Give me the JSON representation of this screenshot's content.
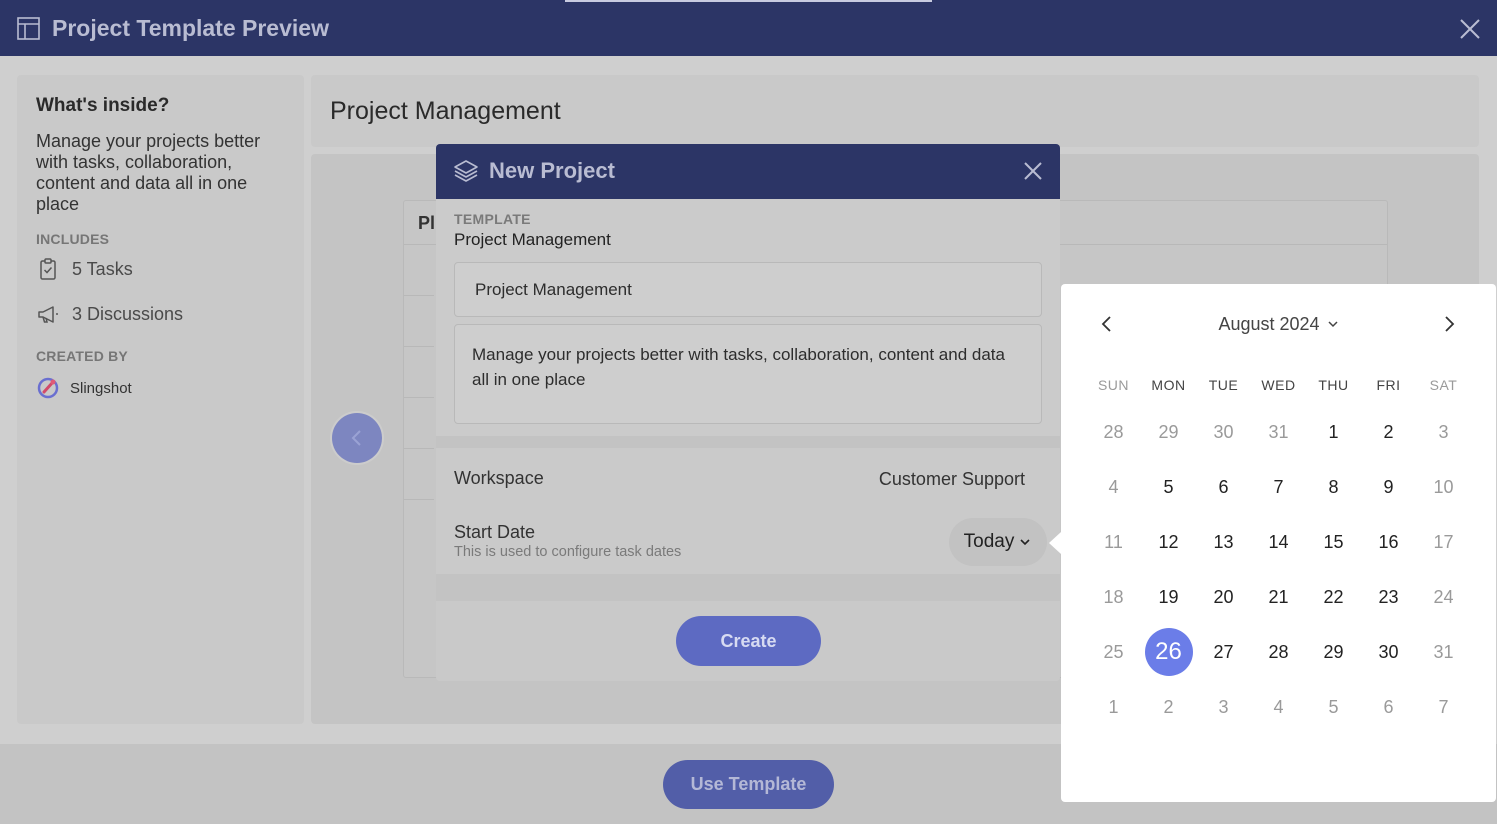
{
  "window": {
    "title": "Project Template Preview"
  },
  "left_panel": {
    "heading": "What's inside?",
    "description": "Manage your projects better with tasks, collaboration, content and data all in one place",
    "includes_label": "INCLUDES",
    "includes": [
      {
        "icon": "clipboard-check-icon",
        "label": "5 Tasks"
      },
      {
        "icon": "megaphone-icon",
        "label": "3 Discussions"
      }
    ],
    "created_by_label": "CREATED BY",
    "creator": "Slingshot"
  },
  "right_panel": {
    "title": "Project Management",
    "preview_header": "Pl"
  },
  "footer": {
    "use_template_label": "Use Template"
  },
  "modal": {
    "title": "New Project",
    "template_label": "TEMPLATE",
    "template_value": "Project Management",
    "name_value": "Project Management",
    "description_value": "Manage your projects better with tasks, collaboration, content and data all in one place",
    "workspace_label": "Workspace",
    "workspace_value": "Customer Support",
    "start_date_label": "Start Date",
    "start_date_hint": "This is used to configure task dates",
    "start_date_value": "Today",
    "create_label": "Create"
  },
  "calendar": {
    "month_label": "August 2024",
    "weekdays": [
      "SUN",
      "MON",
      "TUE",
      "WED",
      "THU",
      "FRI",
      "SAT"
    ],
    "weeks": [
      [
        "28",
        "29",
        "30",
        "31",
        "1",
        "2",
        "3"
      ],
      [
        "4",
        "5",
        "6",
        "7",
        "8",
        "9",
        "10"
      ],
      [
        "11",
        "12",
        "13",
        "14",
        "15",
        "16",
        "17"
      ],
      [
        "18",
        "19",
        "20",
        "21",
        "22",
        "23",
        "24"
      ],
      [
        "25",
        "26",
        "27",
        "28",
        "29",
        "30",
        "31"
      ],
      [
        "1",
        "2",
        "3",
        "4",
        "5",
        "6",
        "7"
      ]
    ],
    "selected_day": "26",
    "accent_color": "#6b7de8"
  }
}
